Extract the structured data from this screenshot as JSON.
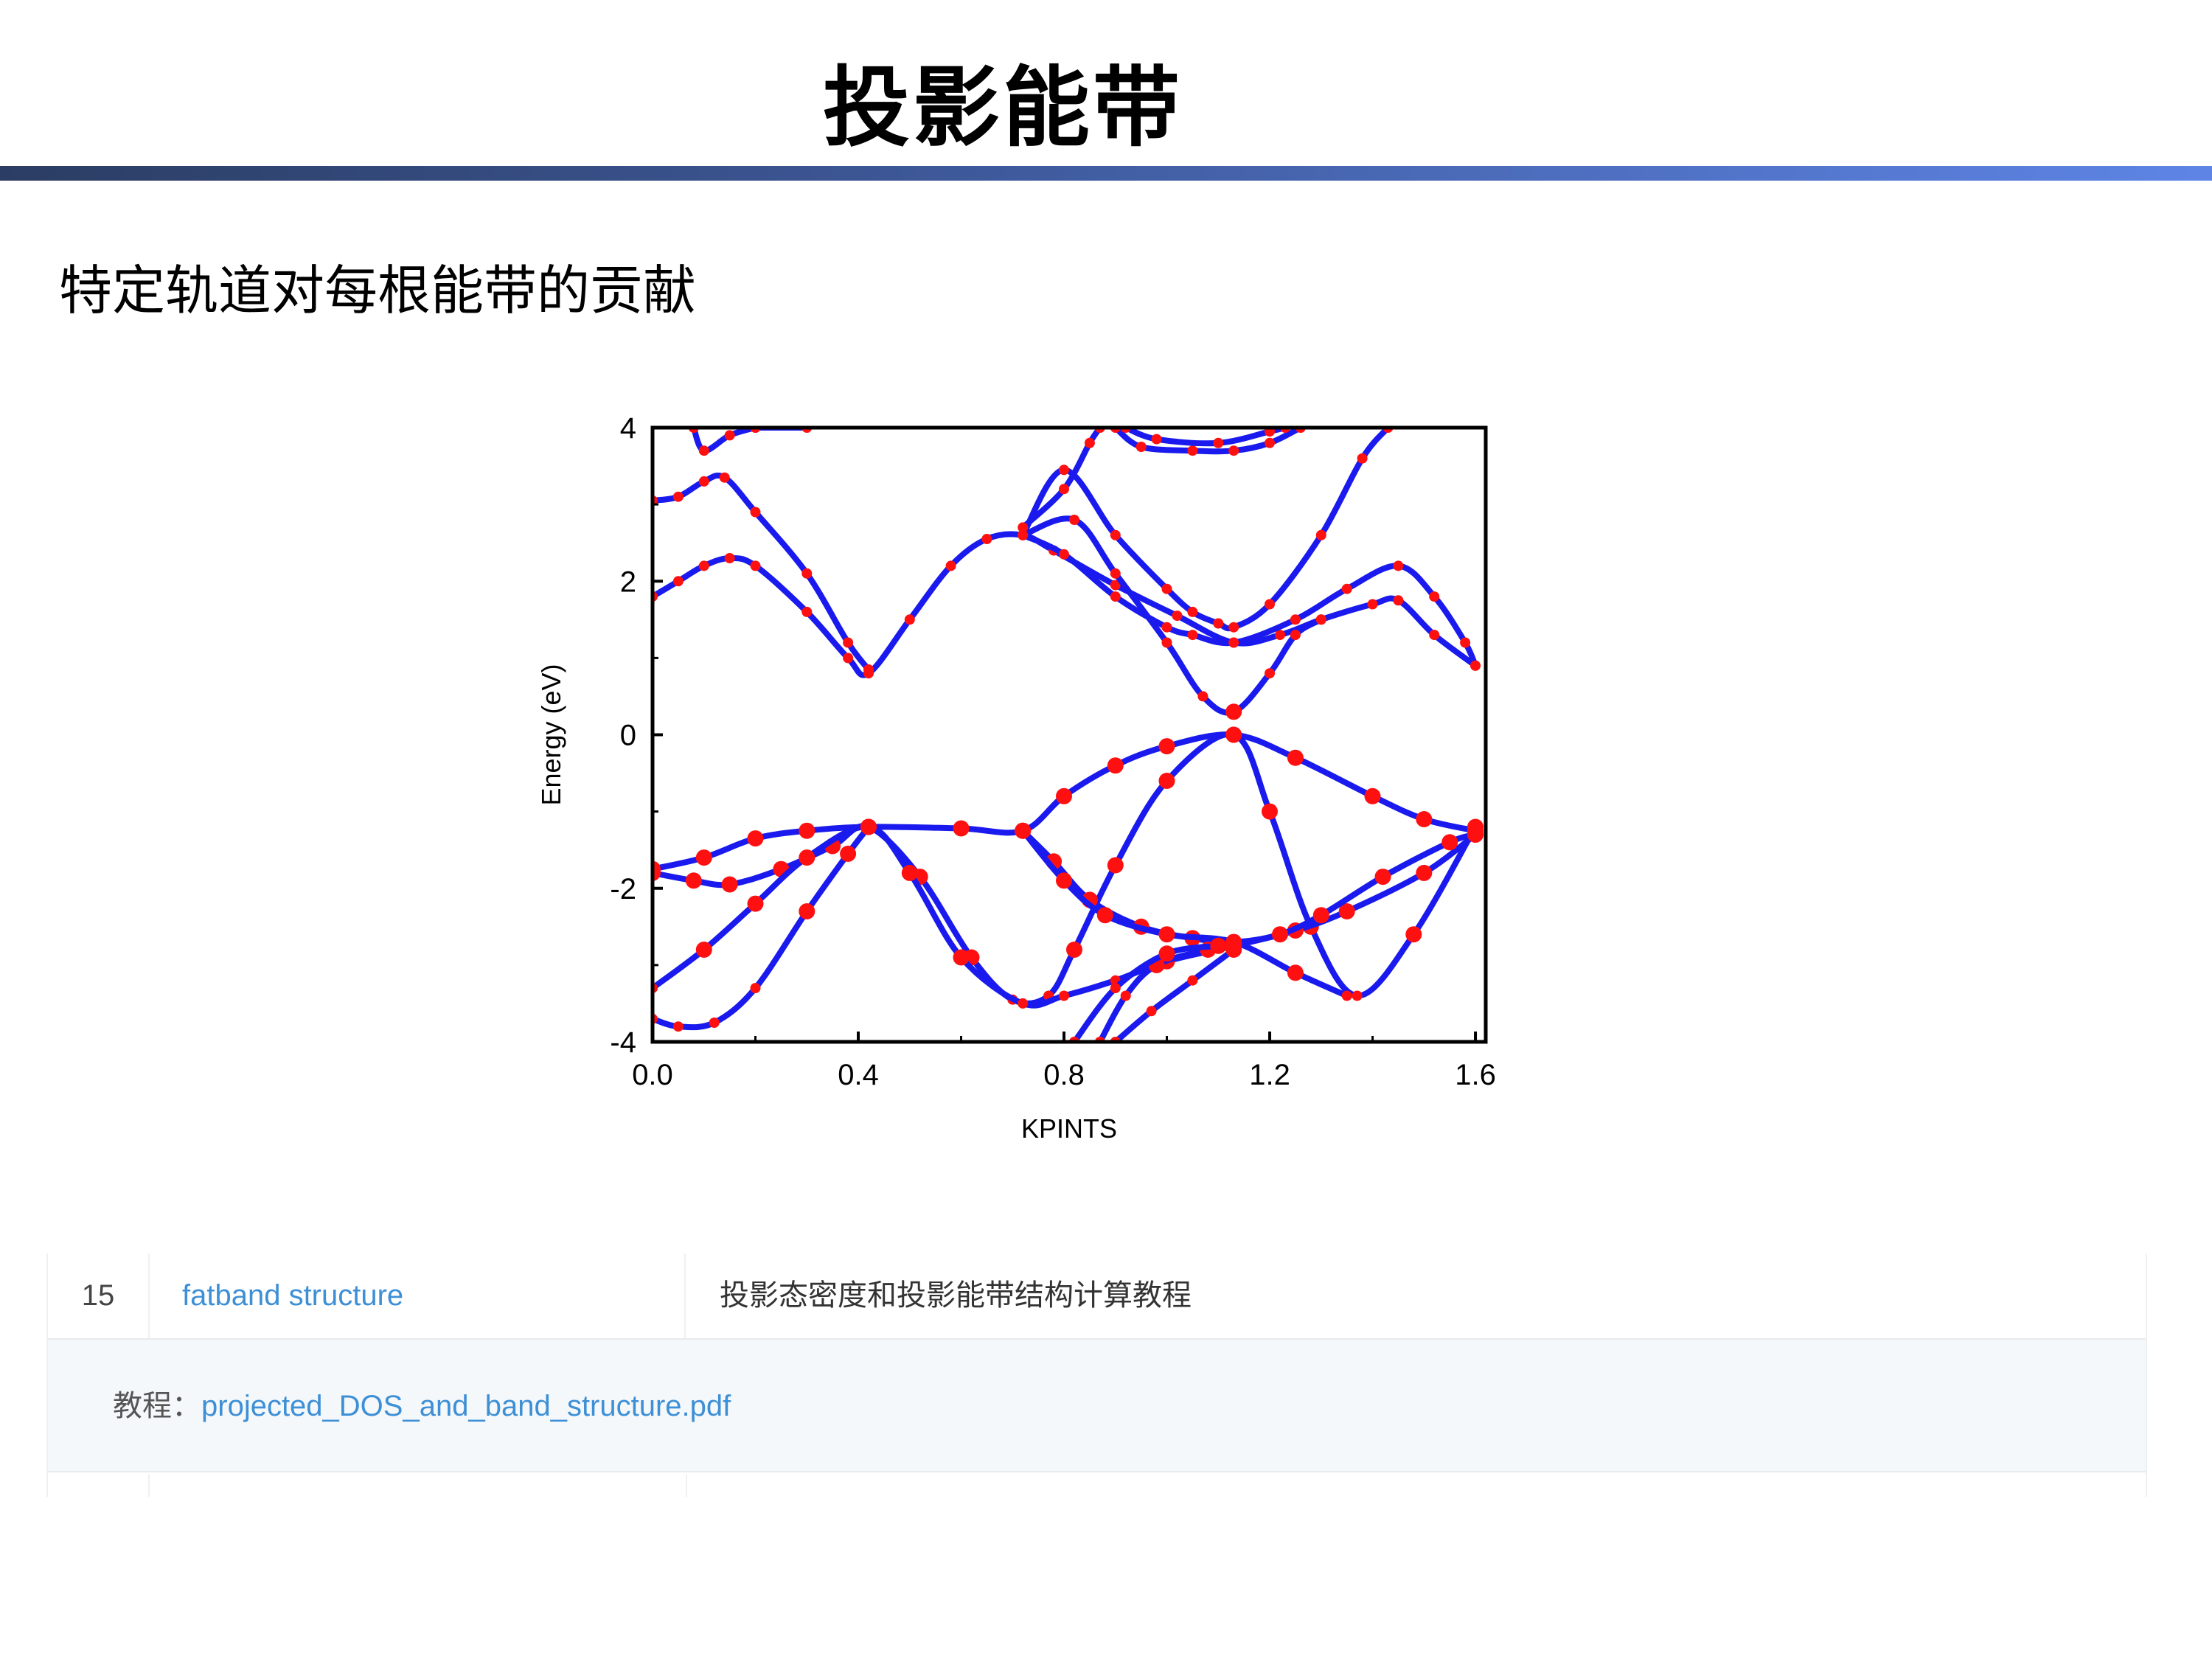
{
  "slide": {
    "title": "投影能带",
    "subtitle": "特定轨道对每根能带的贡献"
  },
  "colors": {
    "band_line": "#1a1aee",
    "projection_dot": "#ff1010",
    "title_bar_start": "#2b3d63",
    "title_bar_end": "#5e85e6",
    "link": "#3d8fd6"
  },
  "chart_data": {
    "type": "scatter",
    "title": "",
    "xlabel": "KPINTS",
    "ylabel": "Energy (eV)",
    "xlim": [
      0.0,
      1.62
    ],
    "ylim": [
      -4,
      4
    ],
    "xticks": [
      "0.0",
      "0.4",
      "0.8",
      "1.2",
      "1.6"
    ],
    "yticks": [
      "4",
      "2",
      "0",
      "-2",
      "-4"
    ],
    "grid": false,
    "legend": "none",
    "series": [
      {
        "values": [
          [
            0,
            -1.75
          ],
          [
            0.1,
            -1.6
          ],
          [
            0.2,
            -1.35
          ],
          [
            0.3,
            -1.25
          ],
          [
            0.42,
            -1.2
          ],
          [
            0.6,
            -1.22
          ],
          [
            0.72,
            -1.25
          ],
          [
            0.8,
            -0.8
          ],
          [
            0.9,
            -0.4
          ],
          [
            1.0,
            -0.15
          ],
          [
            1.13,
            0.0
          ],
          [
            1.25,
            -0.3
          ],
          [
            1.4,
            -0.8
          ],
          [
            1.5,
            -1.1
          ],
          [
            1.6,
            -1.25
          ]
        ]
      },
      {
        "values": [
          [
            0,
            -1.8
          ],
          [
            0.08,
            -1.9
          ],
          [
            0.15,
            -1.95
          ],
          [
            0.25,
            -1.75
          ],
          [
            0.35,
            -1.45
          ],
          [
            0.42,
            -1.2
          ],
          [
            0.52,
            -1.85
          ],
          [
            0.62,
            -2.9
          ],
          [
            0.7,
            -3.45
          ],
          [
            0.77,
            -3.4
          ],
          [
            0.82,
            -2.8
          ],
          [
            0.9,
            -1.7
          ],
          [
            1.0,
            -0.6
          ],
          [
            1.13,
            0.0
          ],
          [
            1.2,
            -1.0
          ],
          [
            1.28,
            -2.5
          ],
          [
            1.37,
            -3.4
          ],
          [
            1.48,
            -2.6
          ],
          [
            1.6,
            -1.2
          ]
        ]
      },
      {
        "values": [
          [
            0,
            -3.3
          ],
          [
            0.1,
            -2.8
          ],
          [
            0.2,
            -2.2
          ],
          [
            0.3,
            -1.6
          ],
          [
            0.42,
            -1.2
          ],
          [
            0.5,
            -1.8
          ],
          [
            0.6,
            -2.9
          ],
          [
            0.72,
            -3.5
          ],
          [
            0.8,
            -3.4
          ],
          [
            0.9,
            -3.2
          ],
          [
            1.0,
            -2.95
          ],
          [
            1.13,
            -2.75
          ],
          [
            1.25,
            -2.55
          ],
          [
            1.35,
            -2.3
          ],
          [
            1.5,
            -1.8
          ],
          [
            1.6,
            -1.3
          ]
        ]
      },
      {
        "values": [
          [
            0,
            -3.7
          ],
          [
            0.05,
            -3.8
          ],
          [
            0.12,
            -3.75
          ],
          [
            0.2,
            -3.3
          ],
          [
            0.3,
            -2.3
          ],
          [
            0.38,
            -1.55
          ],
          [
            0.42,
            -1.2
          ]
        ]
      },
      {
        "values": [
          [
            0.72,
            -1.25
          ],
          [
            0.78,
            -1.65
          ],
          [
            0.85,
            -2.15
          ],
          [
            0.95,
            -2.5
          ],
          [
            1.05,
            -2.65
          ],
          [
            1.13,
            -2.7
          ],
          [
            1.22,
            -2.6
          ],
          [
            1.3,
            -2.35
          ],
          [
            1.42,
            -1.85
          ],
          [
            1.55,
            -1.4
          ],
          [
            1.6,
            -1.3
          ]
        ]
      },
      {
        "values": [
          [
            0.72,
            -1.25
          ],
          [
            0.8,
            -1.9
          ],
          [
            0.88,
            -2.35
          ],
          [
            1.0,
            -2.6
          ],
          [
            1.13,
            -2.7
          ],
          [
            1.25,
            -3.1
          ],
          [
            1.35,
            -3.4
          ]
        ]
      },
      {
        "values": [
          [
            0.87,
            -4.0
          ],
          [
            0.92,
            -3.4
          ],
          [
            0.98,
            -3.0
          ],
          [
            1.08,
            -2.8
          ],
          [
            1.13,
            -2.75
          ]
        ]
      },
      {
        "values": [
          [
            0.82,
            -4.0
          ],
          [
            0.9,
            -3.3
          ],
          [
            1.0,
            -2.85
          ],
          [
            1.1,
            -2.75
          ]
        ]
      },
      {
        "values": [
          [
            0.9,
            -4.0
          ],
          [
            0.97,
            -3.6
          ],
          [
            1.05,
            -3.2
          ],
          [
            1.13,
            -2.8
          ]
        ]
      },
      {
        "values": [
          [
            0,
            1.8
          ],
          [
            0.05,
            2.0
          ],
          [
            0.1,
            2.2
          ],
          [
            0.15,
            2.3
          ],
          [
            0.2,
            2.2
          ],
          [
            0.3,
            1.6
          ],
          [
            0.38,
            1.0
          ],
          [
            0.42,
            0.8
          ],
          [
            0.5,
            1.5
          ],
          [
            0.58,
            2.2
          ],
          [
            0.65,
            2.55
          ],
          [
            0.72,
            2.6
          ],
          [
            0.78,
            2.4
          ],
          [
            0.9,
            1.95
          ],
          [
            1.02,
            1.55
          ],
          [
            1.13,
            1.2
          ],
          [
            1.22,
            1.3
          ],
          [
            1.3,
            1.5
          ],
          [
            1.4,
            1.7
          ],
          [
            1.45,
            1.75
          ],
          [
            1.52,
            1.3
          ],
          [
            1.6,
            0.9
          ]
        ]
      },
      {
        "values": [
          [
            0,
            3.05
          ],
          [
            0.05,
            3.1
          ],
          [
            0.1,
            3.3
          ],
          [
            0.14,
            3.35
          ],
          [
            0.2,
            2.9
          ],
          [
            0.3,
            2.1
          ],
          [
            0.38,
            1.2
          ],
          [
            0.42,
            0.85
          ]
        ]
      },
      {
        "values": [
          [
            0.72,
            2.6
          ],
          [
            0.8,
            2.35
          ],
          [
            0.9,
            1.8
          ],
          [
            1.0,
            1.4
          ],
          [
            1.05,
            1.3
          ],
          [
            1.13,
            1.2
          ],
          [
            1.25,
            1.5
          ],
          [
            1.35,
            1.9
          ],
          [
            1.45,
            2.2
          ],
          [
            1.52,
            1.8
          ],
          [
            1.58,
            1.2
          ],
          [
            1.6,
            0.9
          ]
        ]
      },
      {
        "values": [
          [
            0.72,
            2.6
          ],
          [
            0.82,
            2.8
          ],
          [
            0.9,
            2.1
          ],
          [
            1.0,
            1.2
          ],
          [
            1.07,
            0.5
          ],
          [
            1.13,
            0.3
          ],
          [
            1.2,
            0.8
          ],
          [
            1.25,
            1.3
          ],
          [
            1.3,
            1.5
          ]
        ]
      },
      {
        "values": [
          [
            0.72,
            2.6
          ],
          [
            0.8,
            3.45
          ],
          [
            0.9,
            2.6
          ],
          [
            1.0,
            1.9
          ],
          [
            1.05,
            1.6
          ],
          [
            1.1,
            1.45
          ],
          [
            1.13,
            1.4
          ],
          [
            1.2,
            1.7
          ],
          [
            1.3,
            2.6
          ],
          [
            1.38,
            3.6
          ],
          [
            1.43,
            4.0
          ]
        ]
      },
      {
        "values": [
          [
            0.72,
            2.7
          ],
          [
            0.8,
            3.2
          ],
          [
            0.85,
            3.8
          ],
          [
            0.87,
            4.0
          ]
        ]
      },
      {
        "values": [
          [
            0.9,
            4.0
          ],
          [
            0.95,
            3.75
          ],
          [
            1.05,
            3.7
          ],
          [
            1.13,
            3.7
          ],
          [
            1.2,
            3.8
          ],
          [
            1.26,
            4.0
          ]
        ]
      },
      {
        "values": [
          [
            0.92,
            4.0
          ],
          [
            0.98,
            3.85
          ],
          [
            1.1,
            3.8
          ],
          [
            1.2,
            3.95
          ],
          [
            1.23,
            4.0
          ]
        ]
      },
      {
        "values": [
          [
            0.08,
            4.0
          ],
          [
            0.1,
            3.7
          ],
          [
            0.15,
            3.9
          ],
          [
            0.2,
            4.0
          ]
        ]
      },
      {
        "values": [
          [
            0.2,
            4.0
          ],
          [
            0.3,
            4.0
          ]
        ]
      }
    ]
  },
  "table": {
    "row": {
      "number": "15",
      "name": "fatband structure",
      "description": "投影态密度和投影能带结构计算教程"
    },
    "detail": {
      "label": "教程：",
      "file": "projected_DOS_and_band_structure.pdf"
    }
  }
}
